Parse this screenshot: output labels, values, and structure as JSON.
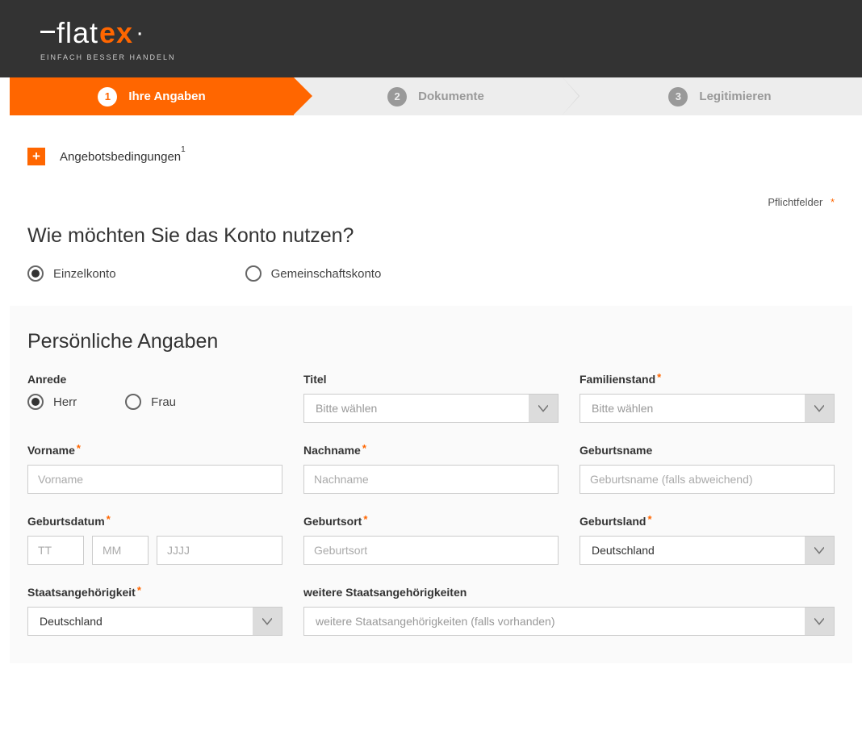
{
  "brand": {
    "name_left": "flat",
    "name_right": "ex",
    "tagline": "EINFACH BESSER HANDELN"
  },
  "stepper": {
    "steps": [
      {
        "num": "1",
        "label": "Ihre Angaben"
      },
      {
        "num": "2",
        "label": "Dokumente"
      },
      {
        "num": "3",
        "label": "Legitimieren"
      }
    ]
  },
  "offer": {
    "label": "Angebotsbedingungen",
    "sup": "1"
  },
  "required_note": "Pflichtfelder",
  "account": {
    "title": "Wie möchten Sie das Konto nutzen?",
    "options": [
      {
        "label": "Einzelkonto",
        "checked": true
      },
      {
        "label": "Gemeinschaftskonto",
        "checked": false
      }
    ]
  },
  "personal": {
    "title": "Persönliche Angaben",
    "anrede": {
      "label": "Anrede",
      "options": [
        {
          "label": "Herr",
          "checked": true
        },
        {
          "label": "Frau",
          "checked": false
        }
      ]
    },
    "titel": {
      "label": "Titel",
      "placeholder": "Bitte wählen"
    },
    "familienstand": {
      "label": "Familienstand",
      "placeholder": "Bitte wählen"
    },
    "vorname": {
      "label": "Vorname",
      "placeholder": "Vorname"
    },
    "nachname": {
      "label": "Nachname",
      "placeholder": "Nachname"
    },
    "geburtsname": {
      "label": "Geburtsname",
      "placeholder": "Geburtsname (falls abweichend)"
    },
    "geburtsdatum": {
      "label": "Geburtsdatum",
      "tt": "TT",
      "mm": "MM",
      "jjjj": "JJJJ"
    },
    "geburtsort": {
      "label": "Geburtsort",
      "placeholder": "Geburtsort"
    },
    "geburtsland": {
      "label": "Geburtsland",
      "value": "Deutschland"
    },
    "staat": {
      "label": "Staatsangehörigkeit",
      "value": "Deutschland"
    },
    "weitere_staat": {
      "label": "weitere Staatsangehörigkeiten",
      "placeholder": "weitere Staatsangehörigkeiten (falls vorhanden)"
    }
  }
}
